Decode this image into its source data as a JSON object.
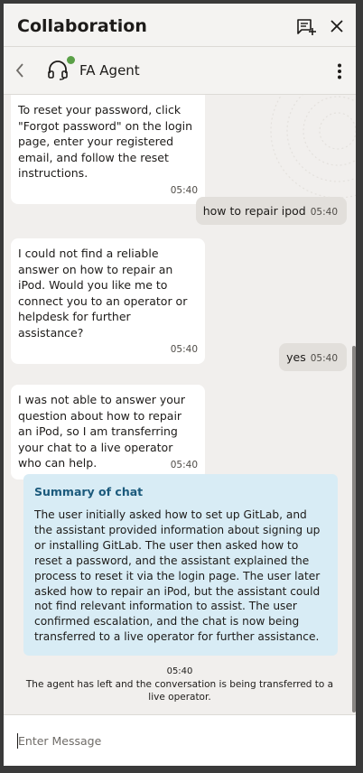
{
  "header": {
    "title": "Collaboration",
    "new_chat_icon": "new-conversation-icon",
    "close_icon": "close-icon"
  },
  "agent_bar": {
    "back_icon": "chevron-left-icon",
    "avatar_icon": "headset-icon",
    "status_color": "#5aa047",
    "name": "FA Agent",
    "menu_icon": "vertical-ellipsis-icon"
  },
  "messages": [
    {
      "from": "bot",
      "text": "To reset your password, click \"Forgot password\" on the login page, enter your registered email, and follow the reset instructions.",
      "time": "05:40"
    },
    {
      "from": "user",
      "text": "how to repair ipod",
      "time": "05:40"
    },
    {
      "from": "bot",
      "text": "I could not find a reliable answer on how to repair an iPod. Would you like me to connect you to an operator or helpdesk for further assistance?",
      "time": "05:40"
    },
    {
      "from": "user",
      "text": "yes",
      "time": "05:40"
    },
    {
      "from": "bot",
      "text": "I was not able to answer your question about how to repair an iPod, so I am transferring your chat to a live operator who can help.",
      "time": "05:40"
    }
  ],
  "summary": {
    "title": "Summary of chat",
    "text": "The user initially asked how to set up GitLab, and the assistant provided information about signing up or installing GitLab. The user then asked how to reset a password, and the assistant explained the process to reset it via the login page. The user later asked how to repair an iPod, but the assistant could not find relevant information to assist. The user confirmed escalation, and the chat is now being transferred to a live operator for further assistance."
  },
  "system": {
    "time": "05:40",
    "message": "The agent has left and the conversation is being transferred to a live operator."
  },
  "input": {
    "placeholder": "Enter Message",
    "value": ""
  },
  "colors": {
    "summary_bg": "#d8ecf5",
    "summary_title": "#1b5a7c",
    "user_bubble": "#e2dfdb",
    "chat_bg": "#f1efed"
  }
}
